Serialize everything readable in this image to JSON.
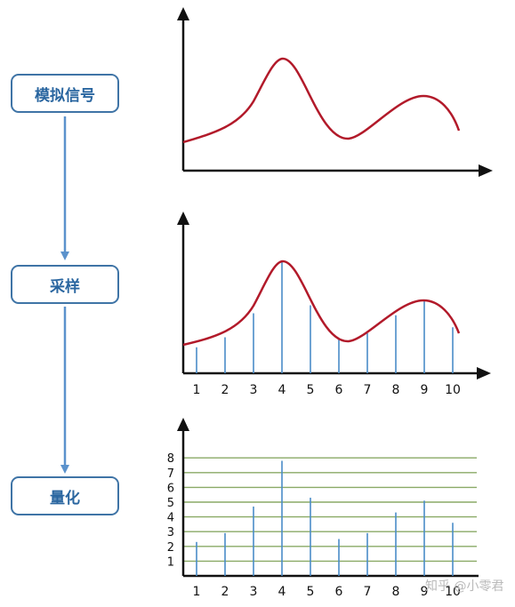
{
  "stages": [
    {
      "label": "模拟信号"
    },
    {
      "label": "采样"
    },
    {
      "label": "量化"
    }
  ],
  "sampling": {
    "x_labels": [
      "1",
      "2",
      "3",
      "4",
      "5",
      "6",
      "7",
      "8",
      "9",
      "10"
    ],
    "values": [
      1.3,
      1.8,
      3.0,
      5.6,
      3.4,
      1.7,
      2.0,
      2.9,
      3.6,
      2.3
    ]
  },
  "quantization": {
    "y_labels": [
      "1",
      "2",
      "3",
      "4",
      "5",
      "6",
      "7",
      "8"
    ],
    "x_labels": [
      "1",
      "2",
      "3",
      "4",
      "5",
      "6",
      "7",
      "8",
      "9",
      "10"
    ],
    "values": [
      2.3,
      2.9,
      4.7,
      7.8,
      5.3,
      2.5,
      2.9,
      4.3,
      5.1,
      3.6
    ]
  },
  "colors": {
    "curve": "#b21a2a",
    "axis": "#111111",
    "stem": "#4a8cc8",
    "grid": "#8aaa66",
    "box_border": "#3f74a6",
    "box_text": "#2a66a0",
    "flow_arrow": "#5b92cc"
  },
  "watermark": "知乎 @小零君"
}
